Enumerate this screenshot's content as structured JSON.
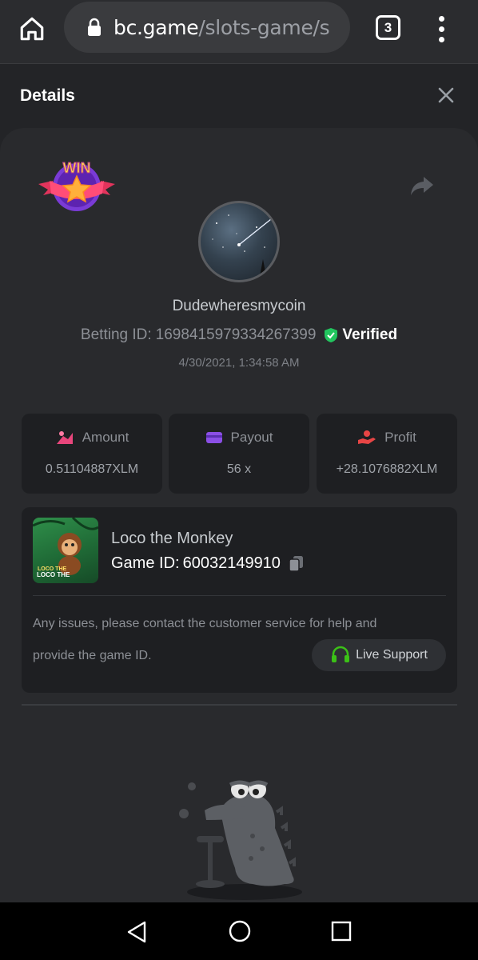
{
  "browser": {
    "url_domain": "bc.game",
    "url_path": "/slots-game/s",
    "tab_count": "3",
    "icons": {
      "home": "home-icon",
      "lock": "lock-icon",
      "menu": "more-vert-icon"
    }
  },
  "header": {
    "title": "Details",
    "close_icon": "close-icon"
  },
  "bet": {
    "username": "Dudewheresmycoin",
    "betting_id_label": "Betting ID:",
    "betting_id": "1698415979334267399",
    "verified_label": "Verified",
    "timestamp": "4/30/2021, 1:34:58 AM"
  },
  "stats": [
    {
      "label": "Amount",
      "value": "0.51104887XLM",
      "icon": "amount-icon",
      "color": "#e8467c"
    },
    {
      "label": "Payout",
      "value": "56 x",
      "icon": "payout-card-icon",
      "color": "#8b4fe6"
    },
    {
      "label": "Profit",
      "value": "+28.1076882XLM",
      "icon": "profit-hand-icon",
      "color": "#e84545"
    }
  ],
  "game": {
    "name": "Loco the Monkey",
    "id_label": "Game ID:",
    "id": "60032149910",
    "thumb_text": "LOCO THE MONKEY",
    "notice_line1": "Any issues, please contact the customer service for help and",
    "notice_line2": "provide the game ID.",
    "support_label": "Live Support"
  },
  "colors": {
    "background": "#232427",
    "panel": "#292a2d",
    "card": "#1e1f22",
    "verified_green": "#22c55e",
    "support_green": "#3bc117"
  }
}
